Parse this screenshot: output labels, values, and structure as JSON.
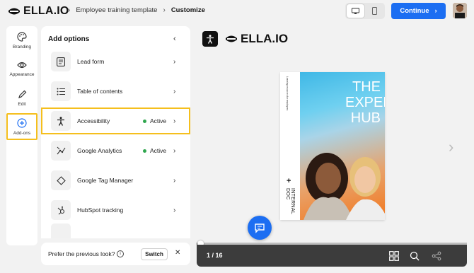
{
  "header": {
    "logo_text": "ELLA.IO",
    "breadcrumb": [
      "Employee training template",
      "Customize"
    ],
    "continue_label": "Continue"
  },
  "rail": {
    "items": [
      {
        "label": "Branding",
        "icon": "palette-icon"
      },
      {
        "label": "Appearance",
        "icon": "eye-icon"
      },
      {
        "label": "Edit",
        "icon": "pencil-icon"
      },
      {
        "label": "Add-ons",
        "icon": "plus-circle-icon",
        "selected": true
      }
    ]
  },
  "panel": {
    "title": "Add options",
    "options": [
      {
        "label": "Lead form",
        "status": "",
        "icon": "form-icon"
      },
      {
        "label": "Table of contents",
        "status": "",
        "icon": "list-icon"
      },
      {
        "label": "Accessibility",
        "status": "Active",
        "icon": "accessibility-icon",
        "highlight": true
      },
      {
        "label": "Google Analytics",
        "status": "Active",
        "icon": "analytics-icon"
      },
      {
        "label": "Google Tag Manager",
        "status": "",
        "icon": "tag-diamond-icon"
      },
      {
        "label": "HubSpot tracking",
        "status": "",
        "icon": "hubspot-icon"
      }
    ],
    "prev_look_text": "Prefer the previous look?",
    "switch_label": "Switch"
  },
  "preview": {
    "brand": "ELLA.IO",
    "cover": {
      "title": "THE EXPERT HUB",
      "side_text": "Learning resources for employees",
      "internal": "INTERNAL DOC"
    },
    "page_indicator": "1 / 16",
    "progress": 0.0
  },
  "colors": {
    "accent": "#1c6ef2",
    "highlight": "#f5bf1d",
    "active_dot": "#2ea64d",
    "viewer_bar": "#3c3c3c"
  }
}
